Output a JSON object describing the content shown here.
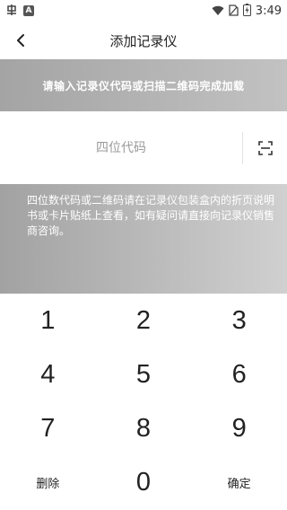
{
  "status_bar": {
    "time": "3:49",
    "left_icons": [
      "app-notification-icon",
      "a-notification-icon"
    ],
    "right_icons": [
      "wifi-icon",
      "no-sim-icon",
      "battery-charging-icon"
    ]
  },
  "header": {
    "title": "添加记录仪",
    "back_icon": "chevron-left-icon"
  },
  "banner": {
    "text": "请输入记录仪代码或扫描二维码完成加载"
  },
  "code_input": {
    "value": "",
    "placeholder": "四位代码",
    "scan_icon": "scan-frame-icon"
  },
  "info": {
    "text": "四位数代码或二维码请在记录仪包装盒内的折页说明书或卡片贴纸上查看，如有疑问请直接向记录仪销售商咨询。"
  },
  "keypad": {
    "keys": [
      "1",
      "2",
      "3",
      "4",
      "5",
      "6",
      "7",
      "8",
      "9"
    ],
    "delete_label": "删除",
    "zero": "0",
    "confirm_label": "确定"
  },
  "colors": {
    "banner_start": "#a4a4a4",
    "banner_end": "#c2c2c2",
    "panel_start": "#a2a2a2",
    "panel_end": "#d0d0d0",
    "text_on_grey": "#ffffff"
  }
}
